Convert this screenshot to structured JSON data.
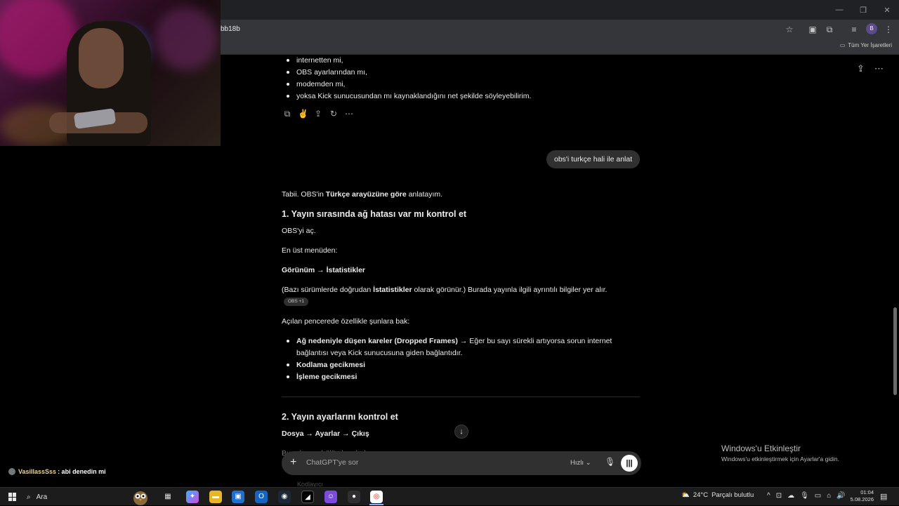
{
  "browser": {
    "url_fragment": "bb18b",
    "profile_initial": "B",
    "bookmarks_all_label": "Tüm Yer İşaretleri"
  },
  "conversation": {
    "prev_bullets": [
      "internetten mi,",
      "OBS ayarlarından mı,",
      "modemden mi,",
      "yoksa Kick sunucusundan mı kaynaklandığını net şekilde söyleyebilirim."
    ],
    "user_message": "obs'i turkçe hali ile anlat",
    "answer": {
      "intro_prefix": "Tabii. OBS'in ",
      "intro_bold": "Türkçe arayüzüne göre",
      "intro_suffix": " anlatayım.",
      "section1_title": "1. Yayın sırasında ağ hatası var mı kontrol et",
      "s1_p1": "OBS'yi aç.",
      "s1_p2": "En üst menüden:",
      "s1_path": "Görünüm → İstatistikler",
      "s1_note_prefix": "(Bazı sürümlerde doğrudan ",
      "s1_note_bold": "İstatistikler",
      "s1_note_suffix": " olarak görünür.) Burada yayınla ilgili ayrıntılı bilgiler yer alır.",
      "source_chip": "OBS +1",
      "s1_p3": "Açılan pencerede özellikle şunlara bak:",
      "s1_bullet1_bold": "Ağ nedeniyle düşen kareler (Dropped Frames)",
      "s1_bullet1_rest": " → Eğer bu sayı sürekli artıyorsa sorun internet bağlantısı veya Kick sunucusuna giden bağlantıdır.",
      "s1_bullet2": "Kodlama gecikmesi",
      "s1_bullet3": "İşleme gecikmesi",
      "section2_title": "2. Yayın ayarlarını kontrol et",
      "s2_path": "Dosya → Ayarlar → Çıkış",
      "s2_cut_line": "Buradan şu bölümlere bak:",
      "s2_cut_line2": "Kodlayıcı"
    }
  },
  "composer": {
    "placeholder": "ChatGPT'ye sor",
    "model_label": "Hızlı"
  },
  "activation": {
    "title": "Windows'u Etkinleştir",
    "subtitle": "Windows'u etkinleştirmek için Ayarlar'a gidin."
  },
  "chat_overlay": {
    "username": "VasillassSss",
    "message": " : abi denedin mi"
  },
  "taskbar": {
    "search_label": "Ara",
    "weather_temp": "24°C",
    "weather_desc": "Parçalı bulutlu",
    "time": "01:04",
    "date": "5.08.2026"
  },
  "colors": {
    "accent_user_bubble": "#303030",
    "page_bg": "#000000"
  }
}
